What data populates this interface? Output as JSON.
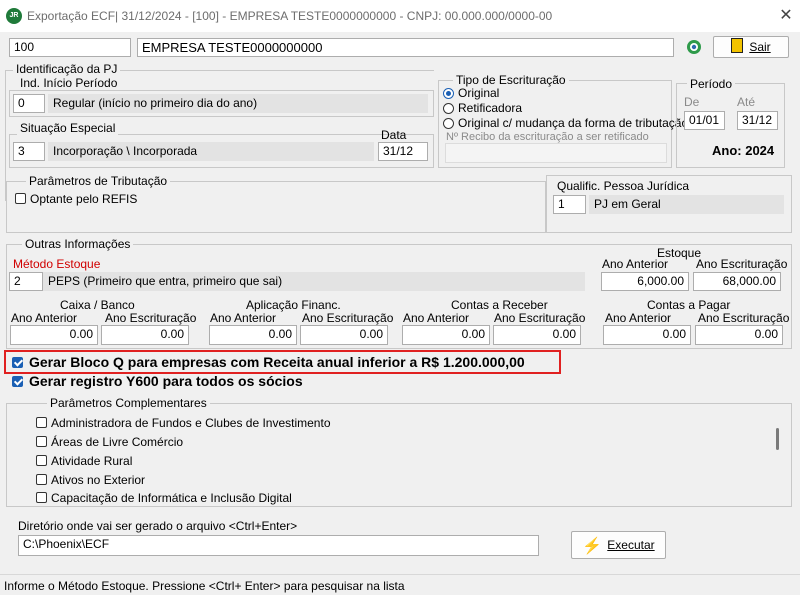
{
  "window": {
    "app_icon_text": "JR",
    "title": "Exportação ECF| 31/12/2024 - [100] - EMPRESA TESTE0000000000 - CNPJ: 00.000.000/0000-00",
    "close_glyph": "✕"
  },
  "header": {
    "company_code": "100",
    "company_name": "EMPRESA TESTE0000000000",
    "exit_label": "Sair"
  },
  "identificacao": {
    "group_label": "Identificação da PJ",
    "ind_inicio": {
      "label": "Ind. Início Período",
      "code": "0",
      "desc": "Regular (início no primeiro dia do ano)"
    },
    "situacao": {
      "label": "Situação Especial",
      "code": "3",
      "desc": "Incorporação \\ Incorporada",
      "data_label": "Data",
      "data_value": "31/12"
    }
  },
  "tipo_escrituracao": {
    "label": "Tipo de Escrituração",
    "options": [
      "Original",
      "Retificadora",
      "Original c/ mudança da forma de tributação"
    ],
    "selected_index": 0,
    "recibo_placeholder": "Nº Recibo da escrituração a ser retificado"
  },
  "periodo": {
    "label": "Período",
    "de_label": "De",
    "de_value": "01/01",
    "ate_label": "Até",
    "ate_value": "31/12",
    "ano_text": "Ano: 2024"
  },
  "tributacao": {
    "label": "Parâmetros de Tributação",
    "refis_label": "Optante pelo REFIS",
    "refis_checked": false,
    "qualific_label": "Qualific. Pessoa Jurídica",
    "qualific_code": "1",
    "qualific_desc": "PJ em Geral"
  },
  "outras": {
    "label": "Outras Informações",
    "metodo_label": "Método Estoque",
    "metodo_code": "2",
    "metodo_desc": "PEPS (Primeiro que entra, primeiro que sai)",
    "estoque": {
      "title": "Estoque",
      "ano_anterior_label": "Ano Anterior",
      "ano_escrit_label": "Ano Escrituração",
      "ano_anterior": "6,000.00",
      "ano_escrit": "68,000.00"
    },
    "caixa": {
      "title": "Caixa / Banco",
      "ano_anterior_label": "Ano  Anterior",
      "ano_escrit_label": "Ano Escrituração",
      "ano_anterior": "0.00",
      "ano_escrit": "0.00"
    },
    "aplicacao": {
      "title": "Aplicação Financ.",
      "ano_anterior_label": "Ano  Anterior",
      "ano_escrit_label": "Ano Escrituração",
      "ano_anterior": "0.00",
      "ano_escrit": "0.00"
    },
    "receber": {
      "title": "Contas a Receber",
      "ano_anterior_label": "Ano Anterior",
      "ano_escrit_label": "Ano Escrituração",
      "ano_anterior": "0.00",
      "ano_escrit": "0.00"
    },
    "pagar": {
      "title": "Contas a Pagar",
      "ano_anterior_label": "Ano Anterior",
      "ano_escrit_label": "Ano Escrituração",
      "ano_anterior": "0.00",
      "ano_escrit": "0.00"
    }
  },
  "bloco_q": {
    "label": "Gerar Bloco Q para empresas com Receita anual inferior a R$ 1.200.000,00",
    "checked": true,
    "highlight_color": "#e02020"
  },
  "y600": {
    "label": "Gerar registro Y600 para todos os sócios",
    "checked": true
  },
  "complementares": {
    "label": "Parâmetros Complementares",
    "items": [
      "Administradora de Fundos e Clubes de Investimento",
      "Áreas de Livre Comércio",
      "Atividade Rural",
      "Ativos no Exterior",
      "Capacitação de Informática e Inclusão Digital"
    ]
  },
  "diretorio": {
    "label": "Diretório onde vai ser gerado o arquivo <Ctrl+Enter>",
    "value": "C:\\Phoenix\\ECF",
    "executar_label": "Executar"
  },
  "status": {
    "text": "Informe o Método Estoque. Pressione <Ctrl+ Enter> para pesquisar na lista"
  },
  "colors": {
    "accent": "#1a5fb4",
    "required_label": "#d00000",
    "readonly_bg": "#e3e3e3"
  }
}
